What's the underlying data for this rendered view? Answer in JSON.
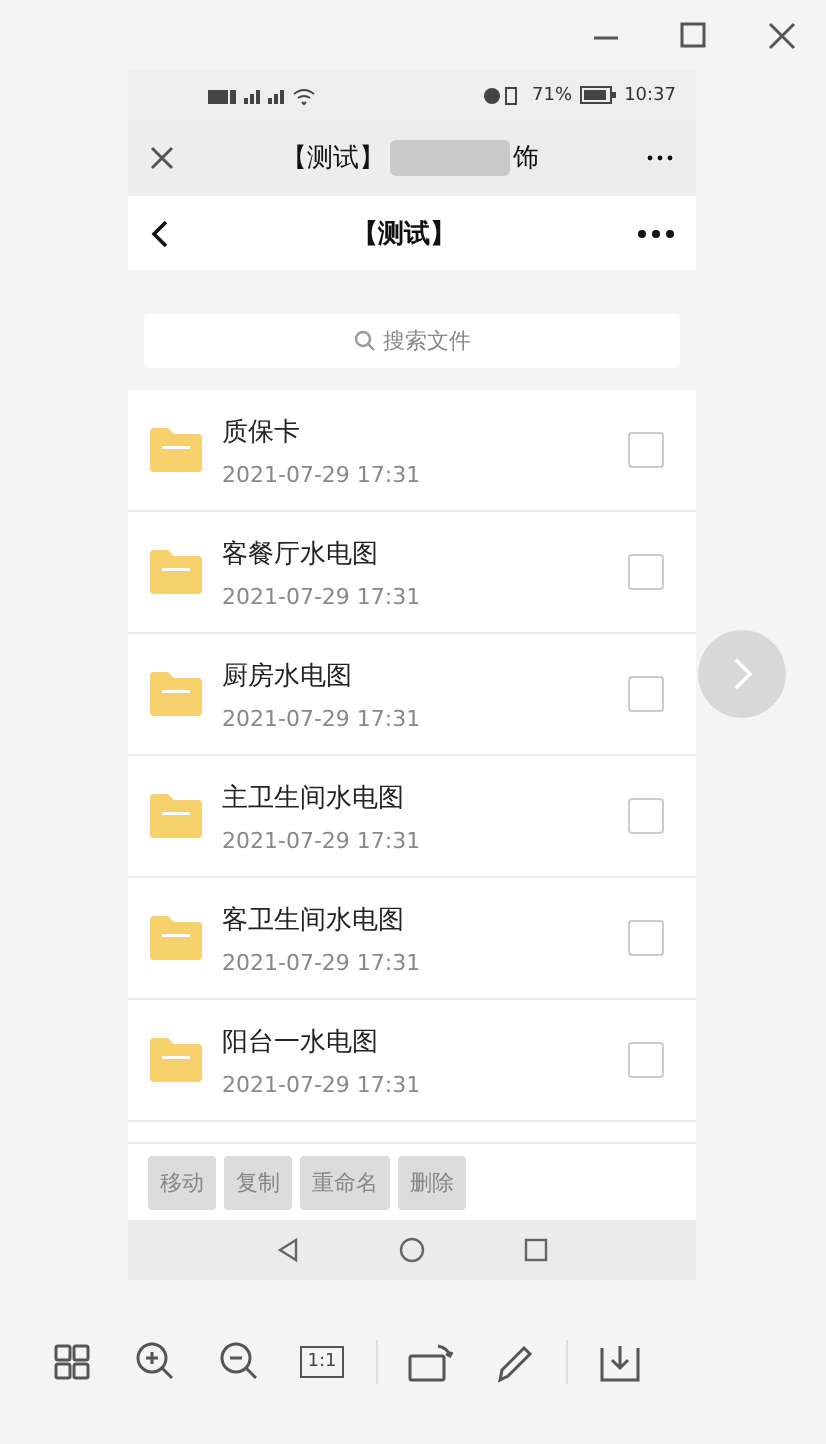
{
  "status_bar": {
    "battery": "71%",
    "time": "10:37"
  },
  "mini_program_bar": {
    "title_start": "【测试】",
    "title_end": "饰"
  },
  "page_header": {
    "title": "【测试】"
  },
  "search": {
    "placeholder": "搜索文件"
  },
  "files": [
    {
      "name": "质保卡",
      "date": "2021-07-29 17:31",
      "checked": false
    },
    {
      "name": "客餐厅水电图",
      "date": "2021-07-29 17:31",
      "checked": false
    },
    {
      "name": "厨房水电图",
      "date": "2021-07-29 17:31",
      "checked": false
    },
    {
      "name": "主卫生间水电图",
      "date": "2021-07-29 17:31",
      "checked": false
    },
    {
      "name": "客卫生间水电图",
      "date": "2021-07-29 17:31",
      "checked": false
    },
    {
      "name": "阳台一水电图",
      "date": "2021-07-29 17:31",
      "checked": false
    }
  ],
  "actions": [
    {
      "label": "移动",
      "disabled": true
    },
    {
      "label": "复制",
      "disabled": true
    },
    {
      "label": "重命名",
      "disabled": true
    },
    {
      "label": "删除",
      "disabled": true
    }
  ],
  "viewer_toolbar": {
    "actual_size_label": "1:1"
  }
}
